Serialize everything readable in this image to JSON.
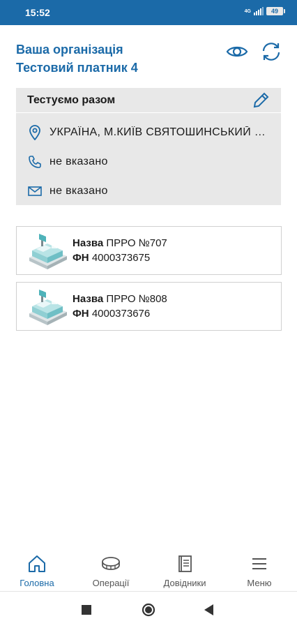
{
  "status_bar": {
    "time": "15:52",
    "network": "4G",
    "battery": "49"
  },
  "header": {
    "line1": "Ваша організація",
    "line2": "Тестовий платник 4"
  },
  "org": {
    "name": "Тестуємо разом",
    "address": "УКРАЇНА, М.КИЇВ СВЯТОШИНСЬКИЙ РАЙОН",
    "phone": "не вказано",
    "email": "не вказано"
  },
  "devices": [
    {
      "name_label": "Назва",
      "name_value": "ПРРО №707",
      "fn_label": "ФН",
      "fn_value": "4000373675"
    },
    {
      "name_label": "Назва",
      "name_value": "ПРРО №808",
      "fn_label": "ФН",
      "fn_value": "4000373676"
    }
  ],
  "nav": [
    {
      "label": "Головна",
      "icon": "home-icon",
      "active": true
    },
    {
      "label": "Операції",
      "icon": "coins-icon",
      "active": false
    },
    {
      "label": "Довідники",
      "icon": "book-icon",
      "active": false
    },
    {
      "label": "Меню",
      "icon": "menu-icon",
      "active": false
    }
  ],
  "colors": {
    "accent": "#1b6aa8",
    "card_bg": "#e8e8e8",
    "text": "#1a1a1a"
  }
}
